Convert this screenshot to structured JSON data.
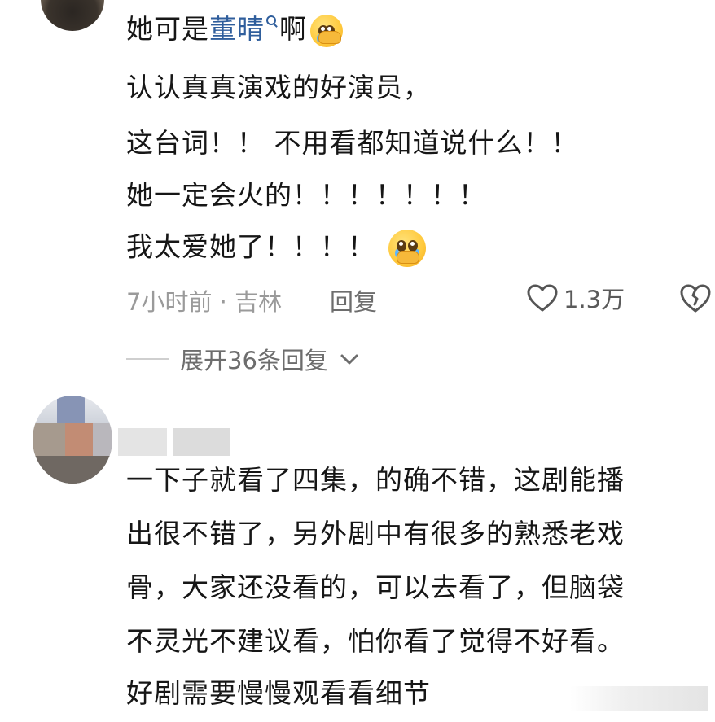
{
  "comment1": {
    "line1_prefix": "她可是",
    "line1_link": "董晴",
    "line1_suffix": "啊",
    "lines": [
      "认认真真演戏的好演员，",
      "这台词！！ 不用看都知道说什么！！",
      "她一定会火的！！！！！！！",
      "我太爱她了！！！！"
    ],
    "meta": "7小时前 · 吉林",
    "reply_label": "回复",
    "like_count": "1.3万",
    "expand_label": "展开36条回复"
  },
  "comment2": {
    "lines": [
      "一下子就看了四集，的确不错，这剧能播",
      "出很不错了，另外剧中有很多的熟悉老戏",
      "骨，大家还没看的，可以去看了，但脑袋",
      "不灵光不建议看，怕你看了觉得不好看。",
      "好剧需要慢慢观看看细节"
    ]
  },
  "icons": {
    "emoji": "crying-pleading-emoji",
    "link_search": "search-icon",
    "like": "heart-outline-icon",
    "dislike": "broken-heart-icon",
    "expand": "chevron-down-icon"
  },
  "colors": {
    "link": "#2f5e9c",
    "meta": "#9a9a9a",
    "text": "#161616"
  }
}
